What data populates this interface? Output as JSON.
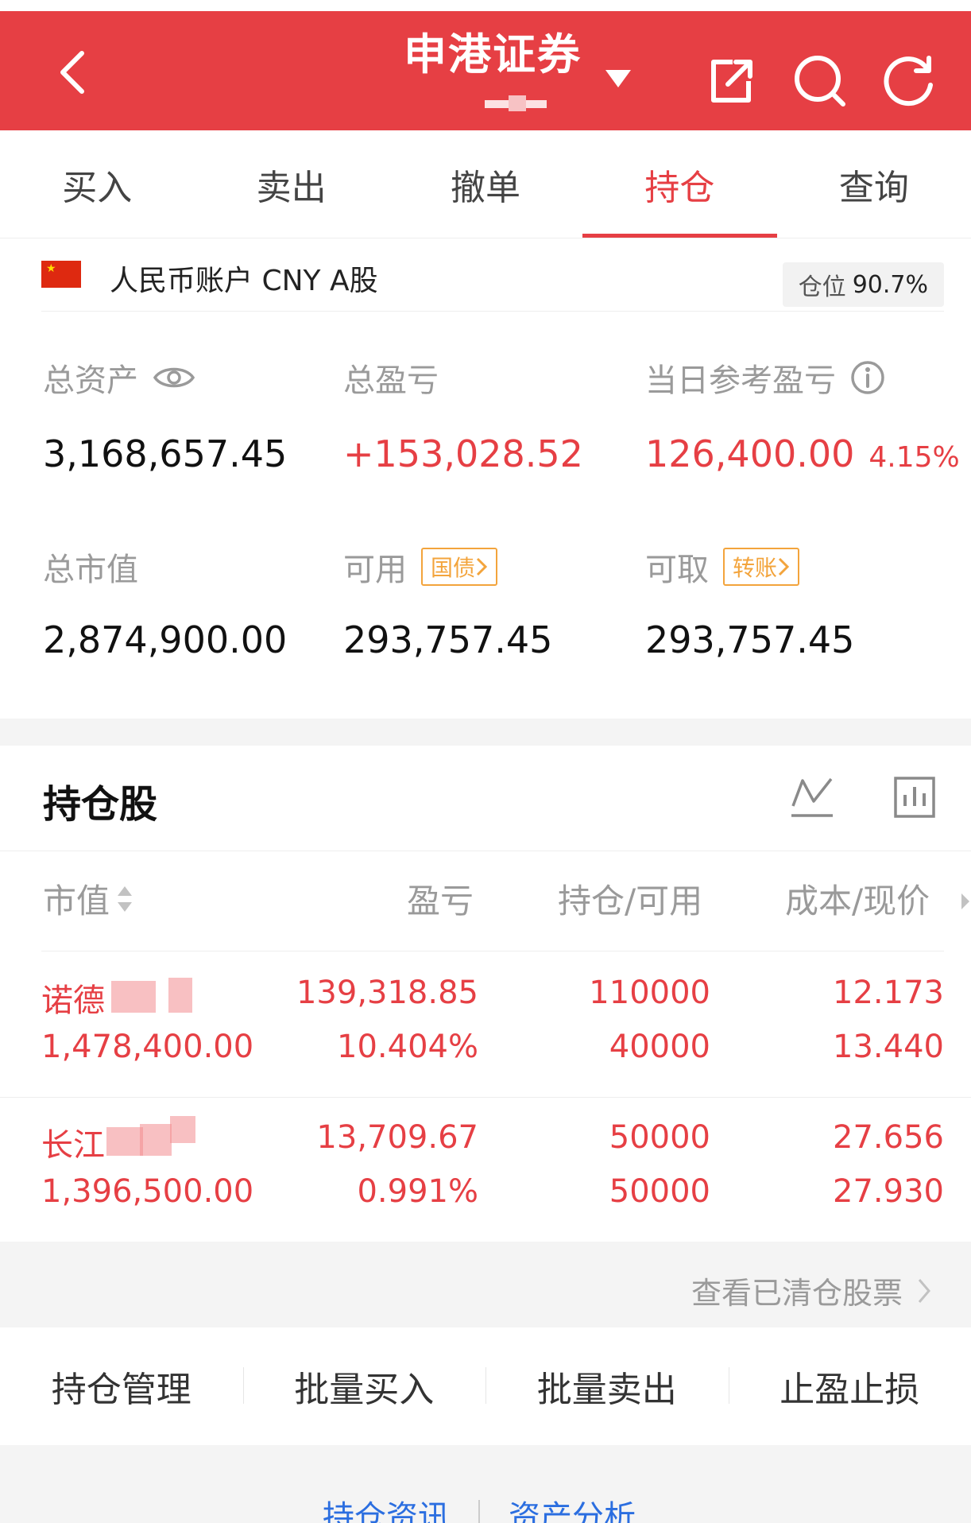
{
  "header": {
    "title": "申港证券",
    "icons": [
      "back-icon",
      "dropdown-icon",
      "share-icon",
      "search-icon",
      "refresh-icon"
    ],
    "accent_color": "#e63f44"
  },
  "tabs": [
    {
      "label": "买入"
    },
    {
      "label": "卖出"
    },
    {
      "label": "撤单"
    },
    {
      "label": "持仓",
      "active": true
    },
    {
      "label": "查询"
    }
  ],
  "account": {
    "label": "人民币账户 CNY A股",
    "position_label": "仓位",
    "position_value": "90.7%"
  },
  "summary": {
    "total_assets_label": "总资产",
    "total_assets": "3,168,657.45",
    "total_pnl_label": "总盈亏",
    "total_pnl": "+153,028.52",
    "daily_pnl_label": "当日参考盈亏",
    "daily_pnl": "126,400.00",
    "daily_pnl_pct": "4.15%",
    "market_value_label": "总市值",
    "market_value": "2,874,900.00",
    "available_label": "可用",
    "available_tag": "国债",
    "available": "293,757.45",
    "withdrawable_label": "可取",
    "withdrawable_tag": "转账",
    "withdrawable": "293,757.45"
  },
  "holdings": {
    "title": "持仓股",
    "columns": [
      "市值",
      "盈亏",
      "持仓/可用",
      "成本/现价"
    ],
    "rows": [
      {
        "name": "诺德",
        "market_value": "1,478,400.00",
        "pnl": "139,318.85",
        "pnl_pct": "10.404%",
        "position": "110000",
        "available": "40000",
        "cost": "12.173",
        "price": "13.440"
      },
      {
        "name": "长江",
        "market_value": "1,396,500.00",
        "pnl": "13,709.67",
        "pnl_pct": "0.991%",
        "position": "50000",
        "available": "50000",
        "cost": "27.656",
        "price": "27.930"
      }
    ],
    "cleared_link": "查看已清仓股票"
  },
  "actions": [
    "持仓管理",
    "批量买入",
    "批量卖出",
    "止盈止损"
  ],
  "bottom_links": [
    "持仓资讯",
    "资产分析"
  ]
}
